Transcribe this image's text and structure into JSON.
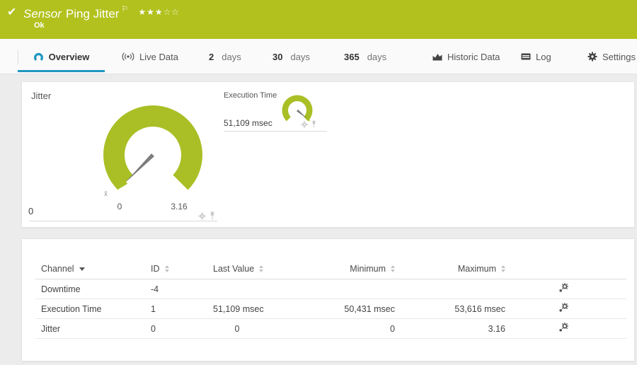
{
  "header": {
    "type_label": "Sensor",
    "title": "Ping Jitter",
    "status": "Ok",
    "rating_filled": "★★★",
    "rating_empty": "☆☆",
    "accent_color": "#b2c11d"
  },
  "tabs": {
    "overview": "Overview",
    "live_data": "Live Data",
    "d2_num": "2",
    "d2_label": "days",
    "d30_num": "30",
    "d30_label": "days",
    "d365_num": "365",
    "d365_label": "days",
    "historic": "Historic Data",
    "log": "Log",
    "settings": "Settings"
  },
  "gauges": {
    "jitter": {
      "name": "Jitter",
      "min_label": "0",
      "max_label": "3.16",
      "last_value": "0",
      "mean_marker": "x̄",
      "color": "#a9bf25"
    },
    "execution_time": {
      "name": "Execution Time",
      "last_value": "51,109 msec",
      "color": "#a9bf25"
    }
  },
  "table": {
    "headers": {
      "channel": "Channel",
      "id": "ID",
      "last_value": "Last Value",
      "minimum": "Minimum",
      "maximum": "Maximum"
    },
    "rows": [
      {
        "channel": "Downtime",
        "id": "-4",
        "last_value": "",
        "minimum": "",
        "maximum": ""
      },
      {
        "channel": "Execution Time",
        "id": "1",
        "last_value": "51,109 msec",
        "minimum": "50,431 msec",
        "maximum": "53,616 msec"
      },
      {
        "channel": "Jitter",
        "id": "0",
        "last_value": "0",
        "minimum": "0",
        "maximum": "3.16"
      }
    ]
  },
  "chart_data": [
    {
      "type": "gauge",
      "title": "Jitter",
      "min": 0,
      "max": 3.16,
      "value": 0,
      "value_label": "0"
    },
    {
      "type": "gauge",
      "title": "Execution Time",
      "value": 51109,
      "value_label": "51,109 msec"
    }
  ]
}
